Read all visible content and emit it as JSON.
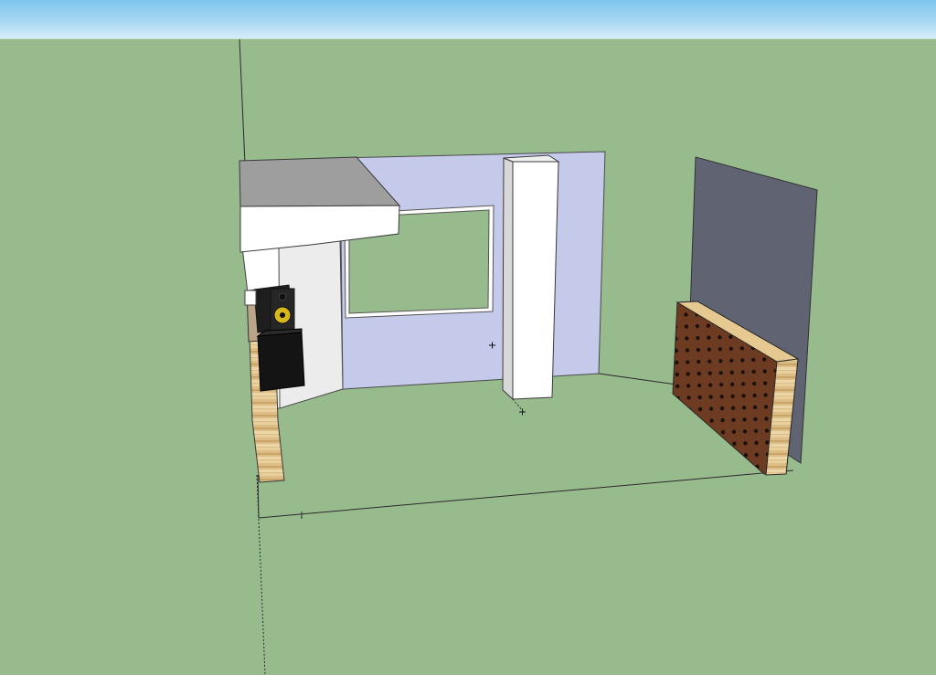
{
  "viewport": {
    "view": "3d-model-viewport",
    "sky_color": "#a8d8f2",
    "ground_color": "#98bb8e"
  },
  "model": {
    "back_wall": {
      "color": "#c5c9ea"
    },
    "ceiling_cloud": {
      "top_color": "#9e9e9e",
      "front_color": "#ffffff"
    },
    "window": {
      "glass_color": "#98bb8e",
      "frame_color": "#ffffff"
    },
    "column": {
      "color": "#ffffff"
    },
    "side_panel": {
      "color": "#5f6372"
    },
    "diffuser": {
      "color": "#6b3a22",
      "edge_color": "#d9b878"
    },
    "left_panel": {
      "color": "#d9b878"
    },
    "speaker_monitor": {
      "cone_color": "#d8b818"
    },
    "subwoofer": {
      "color": "#141414"
    }
  }
}
